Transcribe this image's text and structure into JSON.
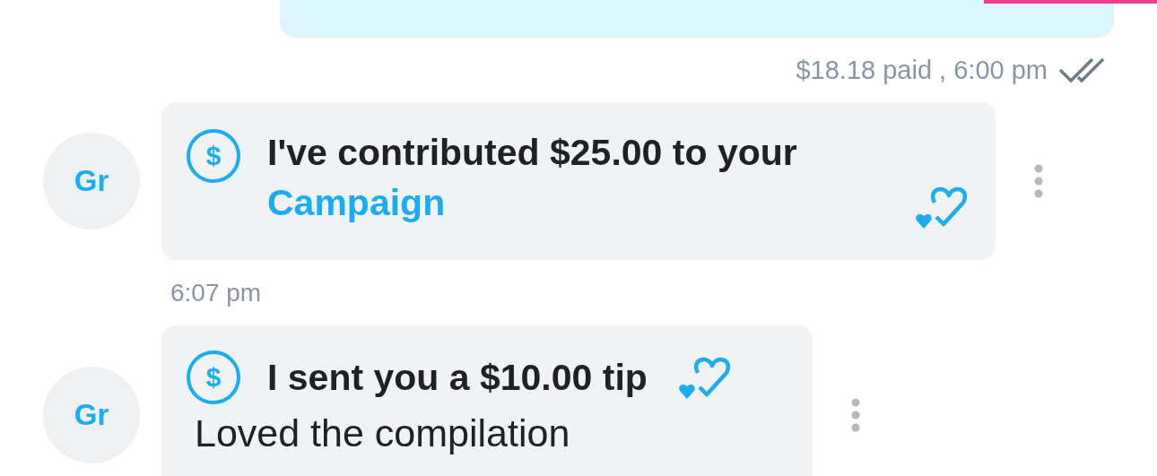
{
  "outgoing_status": {
    "text": "$18.18 paid , 6:00 pm",
    "read": true
  },
  "items": [
    {
      "kind": "campaign",
      "avatar": "Gr",
      "icon": "$",
      "title": "I've contributed $25.00 to your",
      "link": "Campaign"
    },
    {
      "kind": "time",
      "text": "6:07 pm"
    },
    {
      "kind": "tip",
      "avatar": "Gr",
      "icon": "$",
      "title": "I sent you a $10.00 tip",
      "body": "Loved the compilation"
    }
  ]
}
